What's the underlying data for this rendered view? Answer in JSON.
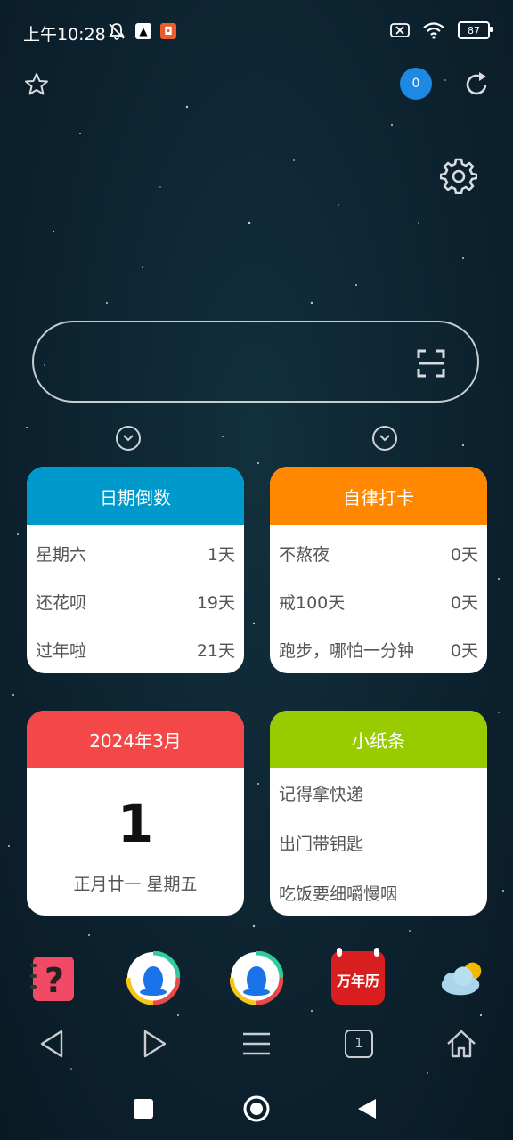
{
  "status_bar": {
    "time": "上午10:28",
    "battery": "87"
  },
  "top": {
    "tab_count": "0"
  },
  "search": {
    "placeholder": ""
  },
  "countdown": {
    "title": "日期倒数",
    "color": "#0099cc",
    "items": [
      {
        "label": "星期六",
        "value": "1天"
      },
      {
        "label": "还花呗",
        "value": "19天"
      },
      {
        "label": "过年啦",
        "value": "21天"
      }
    ]
  },
  "habit": {
    "title": "自律打卡",
    "color": "#ff8800",
    "items": [
      {
        "label": "不熬夜",
        "value": "0天"
      },
      {
        "label": "戒100天",
        "value": "0天"
      },
      {
        "label": "跑步，哪怕一分钟",
        "value": "0天"
      }
    ]
  },
  "calendar": {
    "title": "2024年3月",
    "color": "#f44747",
    "day": "1",
    "footer": "正月廿一  星期五"
  },
  "notes": {
    "title": "小纸条",
    "color": "#99cc00",
    "items": [
      "记得拿快递",
      "出门带钥匙",
      "吃饭要细嚼慢咽"
    ]
  },
  "dock": {
    "calendar_app_label": "万年历"
  },
  "nav": {
    "tabs_count": "1"
  }
}
